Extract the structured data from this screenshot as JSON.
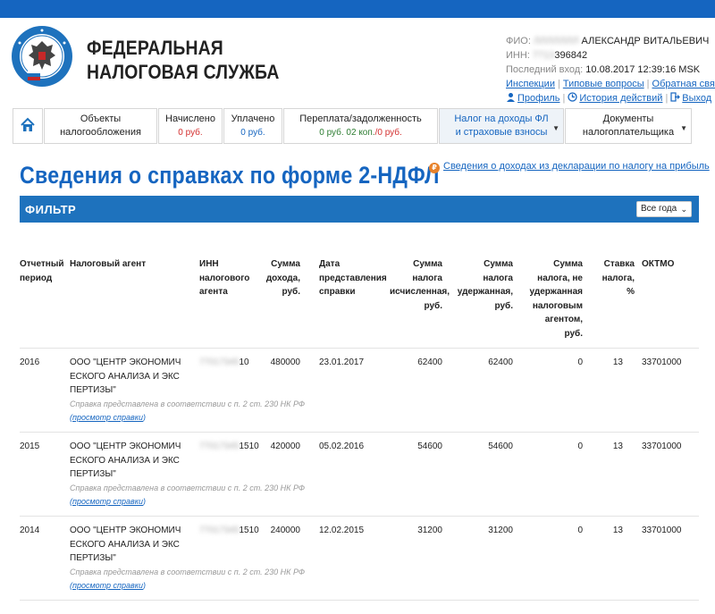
{
  "header": {
    "org_line1": "ФЕДЕРАЛЬНАЯ",
    "org_line2": "НАЛОГОВАЯ СЛУЖБА",
    "logo_ring_text": "ФЕДЕРАЛЬНАЯ НАЛОГОВАЯ СЛУЖБА"
  },
  "user": {
    "fio_label": "ФИО:",
    "fio_hidden": "ЛЛЛЛЛЛЛ",
    "fio_value": "АЛЕКСАНДР ВИТАЛЬЕВИЧ",
    "inn_label": "ИНН:",
    "inn_hidden": "7713",
    "inn_value": "396842",
    "last_login_label": "Последний вход:",
    "last_login_value": "10.08.2017 12:39:16 MSK",
    "links_row1": [
      "Инспекции",
      "Типовые вопросы",
      "Обратная связь"
    ],
    "profile": "Профиль",
    "history": "История действий",
    "logout": "Выход"
  },
  "nav": {
    "items": [
      {
        "label": "Объекты",
        "sub": "налогообложения",
        "value": ""
      },
      {
        "label": "Начислено",
        "sub": "",
        "value": "0 руб."
      },
      {
        "label": "Уплачено",
        "sub": "",
        "value": "0 руб."
      },
      {
        "label": "Переплата/задолженность",
        "sub": "",
        "value_green": "0 руб. 02 коп.",
        "value_red": "/0 руб."
      },
      {
        "label": "Налог на доходы ФЛ",
        "sub": "и страховые взносы",
        "value": ""
      },
      {
        "label": "Документы",
        "sub": "налогоплательщика",
        "value": ""
      }
    ]
  },
  "page": {
    "title": "Сведения о справках по форме 2-НДФЛ",
    "side_link": "Сведения о доходах из декларации по налогу на прибыль"
  },
  "filter": {
    "title": "ФИЛЬТР",
    "select_value": "Все года"
  },
  "table": {
    "headers": {
      "period": "Отчетный период",
      "agent": "Налоговый агент",
      "inn": "ИНН налогового агента",
      "income": "Сумма дохода, руб.",
      "date": "Дата представления справки",
      "calc": "Сумма налога исчисленная, руб.",
      "withheld": "Сумма налога удержанная, руб.",
      "not_withheld": "Сумма налога, не удержанная налоговым агентом, руб.",
      "rate": "Ставка налога, %",
      "oktmo": "ОКТМО"
    },
    "rows": [
      {
        "period": "2016",
        "agent": "ООО \"ЦЕНТР ЭКОНОМИЧ ЕСКОГО АНАЛИЗА И ЭКС ПЕРТИЗЫ\"",
        "inn_hidden": "77017345",
        "inn_tail": "10",
        "income": "480000",
        "date": "23.01.2017",
        "calc": "62400",
        "withheld": "62400",
        "not_withheld": "0",
        "rate": "13",
        "oktmo": "33701000",
        "note": "Справка представлена в соответствии с п. 2 ст. 230 НК РФ",
        "link": "просмотр справки"
      },
      {
        "period": "2015",
        "agent": "ООО \"ЦЕНТР ЭКОНОМИЧ ЕСКОГО АНАЛИЗА И ЭКС ПЕРТИЗЫ\"",
        "inn_hidden": "77017345",
        "inn_tail": "1510",
        "income": "420000",
        "date": "05.02.2016",
        "calc": "54600",
        "withheld": "54600",
        "not_withheld": "0",
        "rate": "13",
        "oktmo": "33701000",
        "note": "Справка представлена в соответствии с п. 2 ст. 230 НК РФ",
        "link": "просмотр справки"
      },
      {
        "period": "2014",
        "agent": "ООО \"ЦЕНТР ЭКОНОМИЧ ЕСКОГО АНАЛИЗА И ЭКС ПЕРТИЗЫ\"",
        "inn_hidden": "77017345",
        "inn_tail": "1510",
        "income": "240000",
        "date": "12.02.2015",
        "calc": "31200",
        "withheld": "31200",
        "not_withheld": "0",
        "rate": "13",
        "oktmo": "33701000",
        "note": "Справка представлена в соответствии с п. 2 ст. 230 НК РФ",
        "link": "просмотр справки"
      }
    ]
  },
  "colors": {
    "brand_blue": "#1565c0",
    "filter_bar": "#1e72bd",
    "value_red": "#d32f2f",
    "value_green": "#2e7d32"
  }
}
